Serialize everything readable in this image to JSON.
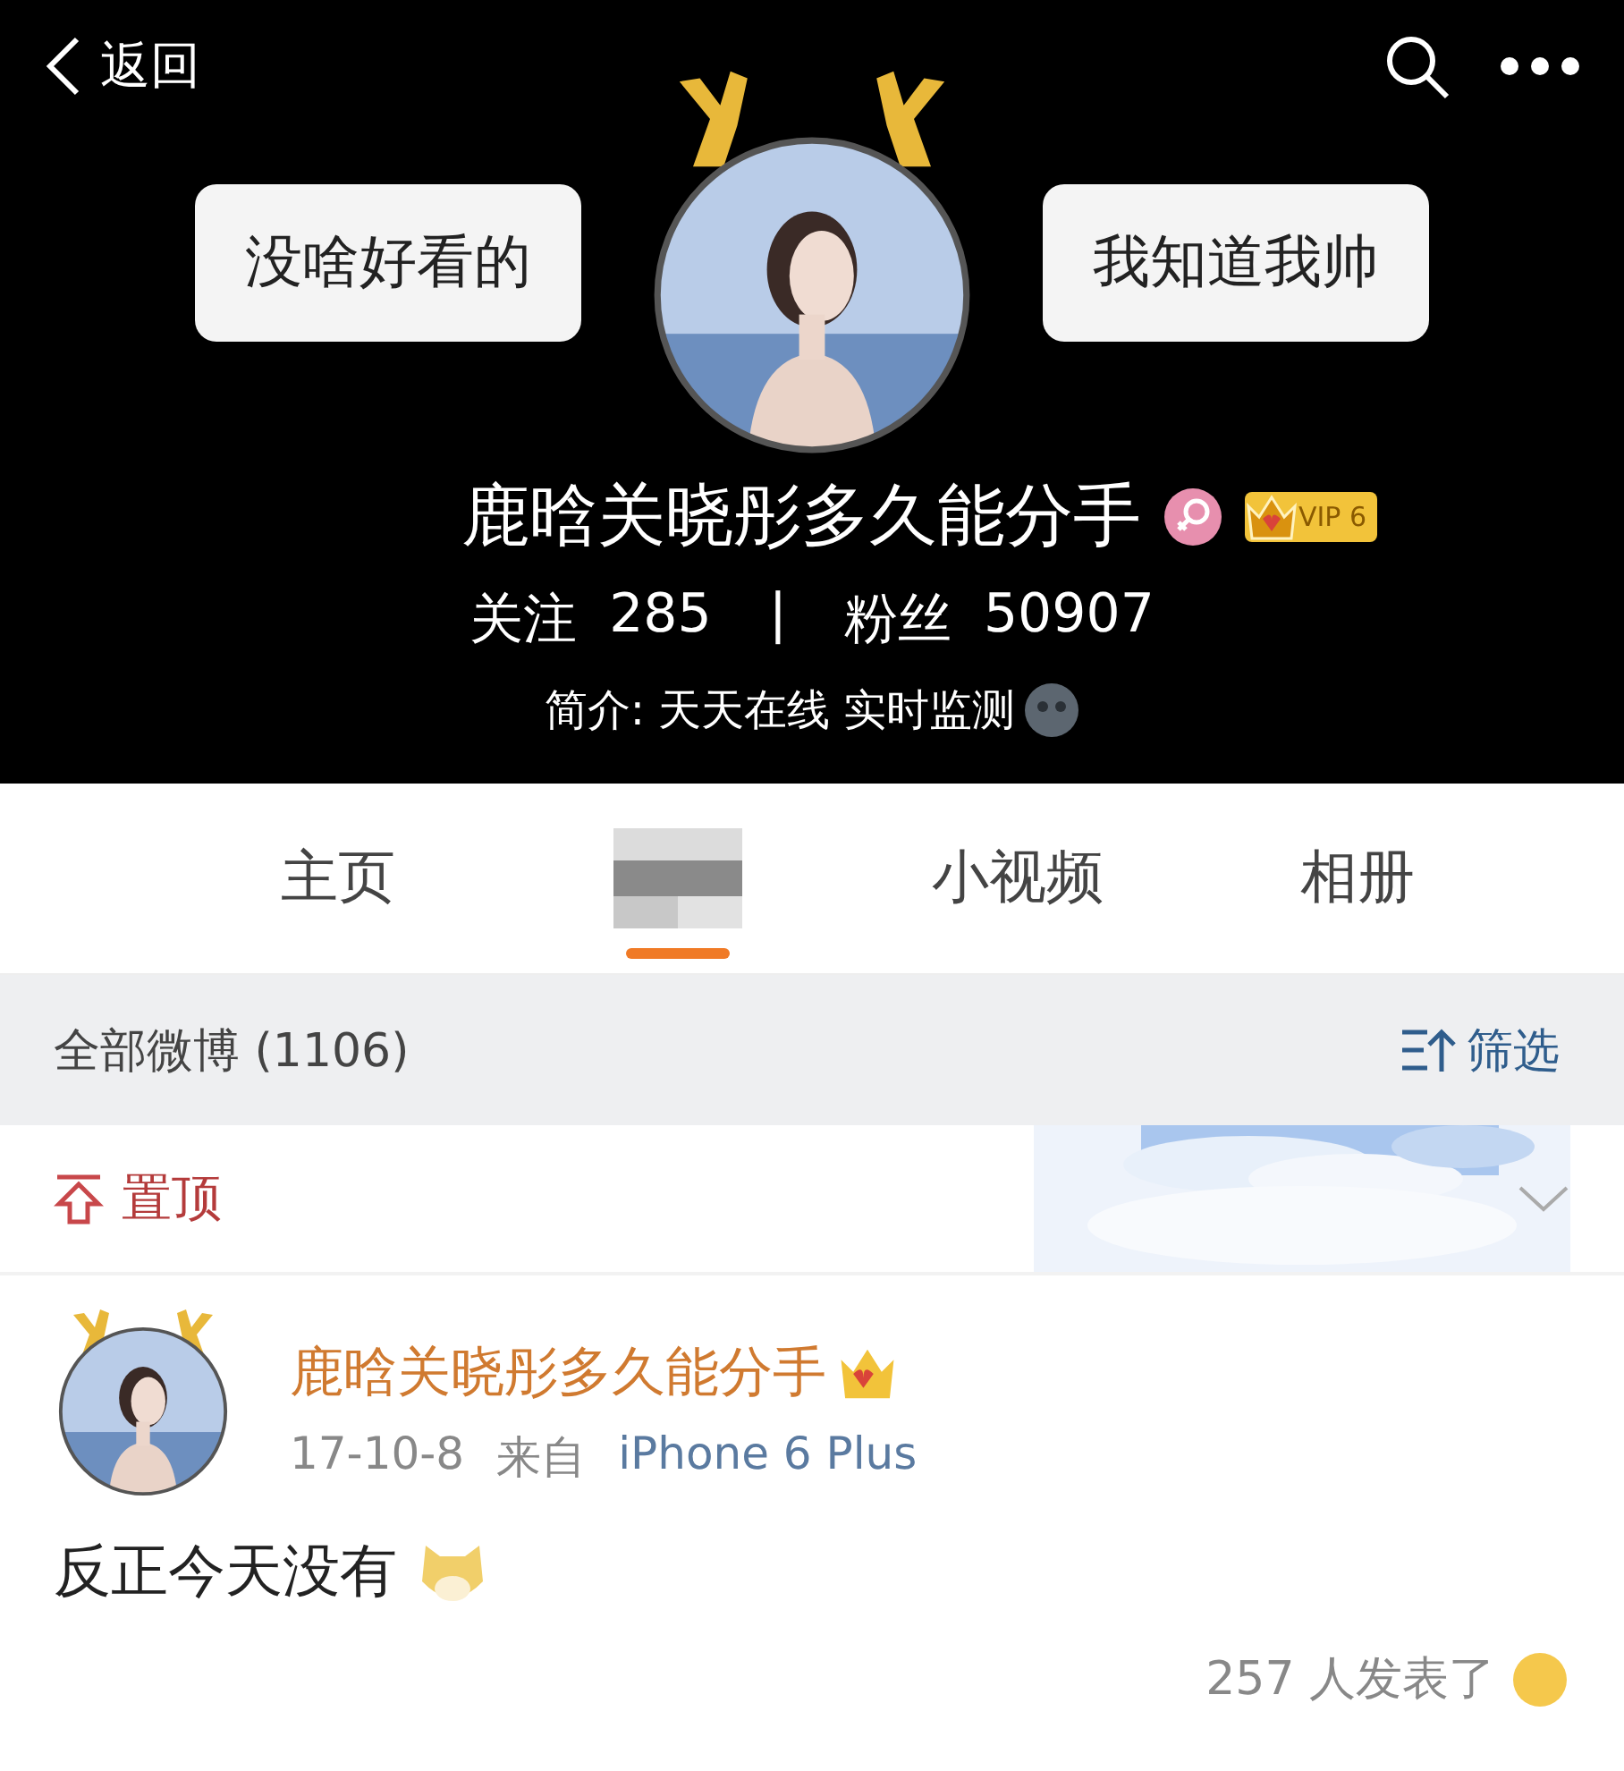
{
  "header": {
    "back": "返回",
    "bubbles": [
      "没啥好看的",
      "我知道我帅"
    ],
    "name": "鹿晗关晓彤多久能分手",
    "vip": "VIP 6",
    "follow_label": "关注",
    "follow_count": "285",
    "separator": "|",
    "fans_label": "粉丝",
    "fans_count": "50907",
    "bio": "简介: 天天在线 实时监测"
  },
  "tabs": [
    {
      "kind": "text",
      "label": "主页",
      "selected": false
    },
    {
      "kind": "blurred",
      "selected": true
    },
    {
      "kind": "text",
      "label": "小视频",
      "selected": false
    },
    {
      "kind": "text",
      "label": "相册",
      "selected": false
    }
  ],
  "filter_bar": {
    "count_label": "全部微博 (1106)",
    "filter": "筛选"
  },
  "pinned": {
    "label": "置顶"
  },
  "post": {
    "author": "鹿晗关晓彤多久能分手",
    "date": "17-10-8",
    "source_prefix": "来自",
    "source": "iPhone 6 Plus",
    "text": "反正今天没有",
    "reactions": "257 人发表了"
  }
}
